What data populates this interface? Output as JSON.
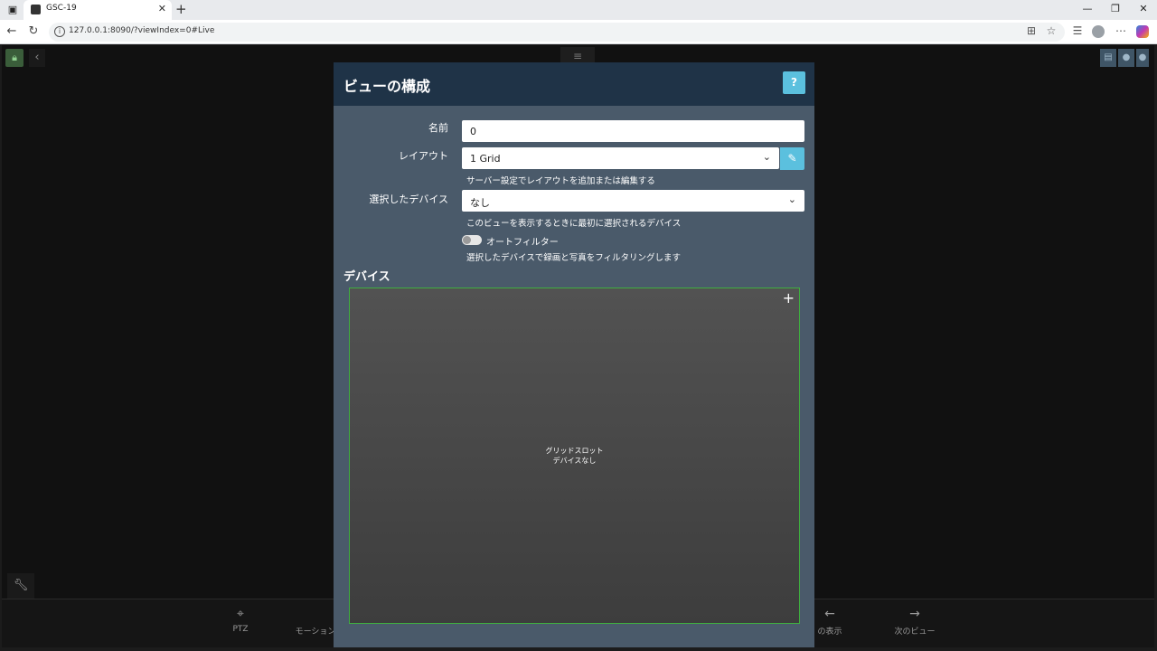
{
  "browser": {
    "tab_title": "GSC-19",
    "url": "127.0.0.1:8090/?viewIndex=0#Live"
  },
  "app": {
    "bottom_bar": [
      {
        "icon": "crosshair-icon",
        "label": "PTZ"
      },
      {
        "icon": "motion-icon",
        "label": "モーション"
      },
      {
        "icon": "arrow-left-icon",
        "label": "の表示"
      },
      {
        "icon": "arrow-right-icon",
        "label": "次のビュー"
      }
    ]
  },
  "modal": {
    "title": "ビューの構成",
    "help_label": "?",
    "name_label": "名前",
    "name_value": "0",
    "layout_label": "レイアウト",
    "layout_value": "1 Grid",
    "layout_hint": "サーバー設定でレイアウトを追加または編集する",
    "device_label": "選択したデバイス",
    "device_value": "なし",
    "device_hint": "このビューを表示するときに最初に選択されるデバイス",
    "autofilter_label": "オートフィルター",
    "autofilter_on": false,
    "autofilter_hint": "選択したデバイスで録画と写真をフィルタリングします",
    "devices_section": "デバイス",
    "slot_line1": "グリッドスロット",
    "slot_line2": "デバイスなし"
  }
}
